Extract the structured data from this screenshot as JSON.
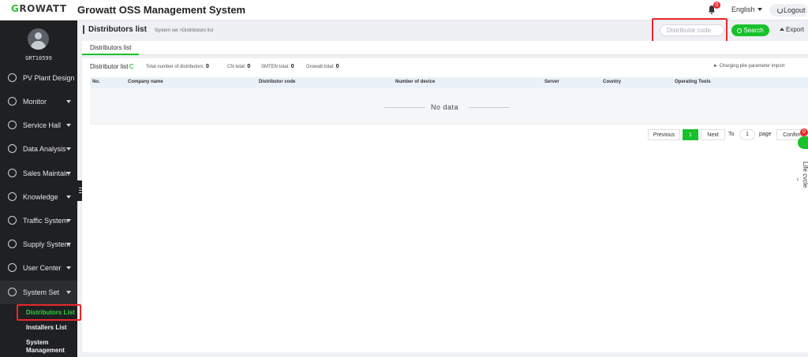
{
  "header": {
    "logo_first": "G",
    "logo_rest": "ROWATT",
    "title": "Growatt OSS Management System",
    "notif_count": "0",
    "language": "English",
    "logout": "Logout"
  },
  "sidebar": {
    "username": "GRT10599",
    "items": [
      {
        "label": "PV Plant Design",
        "arrow": false
      },
      {
        "label": "Monitor",
        "arrow": true
      },
      {
        "label": "Service Hall",
        "arrow": true
      },
      {
        "label": "Data Analysis",
        "arrow": true
      },
      {
        "label": "Sales Maintain",
        "arrow": true
      },
      {
        "label": "Knowledge",
        "arrow": true
      },
      {
        "label": "Traffic System",
        "arrow": true
      },
      {
        "label": "Supply System",
        "arrow": true
      },
      {
        "label": "User Center",
        "arrow": true
      },
      {
        "label": "System Set",
        "arrow": true,
        "active": true
      }
    ],
    "subitems": [
      {
        "label": "Distributors List",
        "active": true
      },
      {
        "label": "Installers List"
      },
      {
        "label": "System Management"
      }
    ]
  },
  "page": {
    "title": "Distributors list",
    "breadcrumb": "System set >Distributors list",
    "search_placeholder": "Distributor code",
    "search_label": "Search",
    "export_label": "Export",
    "tab": "Distributors list"
  },
  "list": {
    "heading": "Distributor list",
    "stats": [
      {
        "label": "Total number of distributors:",
        "value": "0"
      },
      {
        "label": "CN total:",
        "value": "0"
      },
      {
        "label": "SMTEN total:",
        "value": "0"
      },
      {
        "label": "Growatt total:",
        "value": "0"
      }
    ],
    "import_label": "Charging pile parameter import",
    "columns": [
      "No.",
      "Company name",
      "Distributor code",
      "Number of device",
      "Server",
      "Country",
      "Operating Tools"
    ],
    "empty_text": "No data"
  },
  "pager": {
    "previous": "Previous",
    "current": "1",
    "next": "Next",
    "to": "To",
    "page_input": "1",
    "page": "page",
    "confirm": "Confirm"
  },
  "floating": {
    "badge": "0",
    "life_cycle": "Life cycle"
  },
  "colors": {
    "accent": "#17c22a",
    "sidebar_bg": "#1f2022",
    "alert": "#e8282b"
  }
}
